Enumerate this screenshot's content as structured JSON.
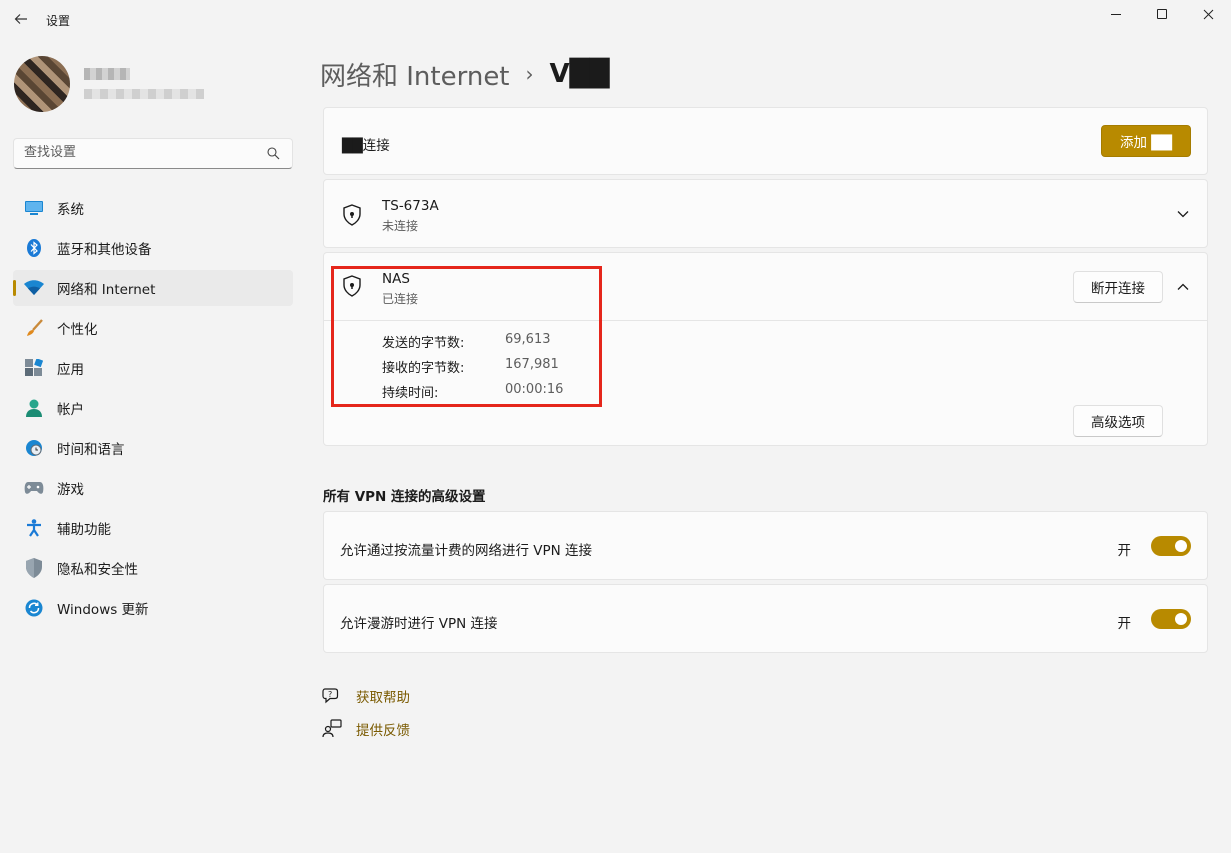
{
  "window": {
    "title": "设置"
  },
  "user": {
    "name": "",
    "email": ""
  },
  "search": {
    "placeholder": "查找设置"
  },
  "sidebar": {
    "items": [
      {
        "label": "系统",
        "icon": "system-icon"
      },
      {
        "label": "蓝牙和其他设备",
        "icon": "bluetooth-icon"
      },
      {
        "label": "网络和 Internet",
        "icon": "wifi-icon",
        "active": true
      },
      {
        "label": "个性化",
        "icon": "brush-icon"
      },
      {
        "label": "应用",
        "icon": "apps-icon"
      },
      {
        "label": "帐户",
        "icon": "account-icon"
      },
      {
        "label": "时间和语言",
        "icon": "globe-clock-icon"
      },
      {
        "label": "游戏",
        "icon": "gamepad-icon"
      },
      {
        "label": "辅助功能",
        "icon": "accessibility-icon"
      },
      {
        "label": "隐私和安全性",
        "icon": "shield-icon"
      },
      {
        "label": "Windows 更新",
        "icon": "update-icon"
      }
    ]
  },
  "breadcrumb": {
    "parent": "网络和 Internet",
    "separator": "›",
    "current": "V██"
  },
  "vpn_connections": {
    "label": "██连接",
    "add_button": "添加 ██"
  },
  "connections": [
    {
      "name": "TS-673A",
      "status": "未连接"
    },
    {
      "name": "NAS",
      "status": "已连接",
      "disconnect_button": "断开连接",
      "advanced_button": "高级选项",
      "stats": [
        {
          "label": "发送的字节数:",
          "value": "69,613"
        },
        {
          "label": "接收的字节数:",
          "value": "167,981"
        },
        {
          "label": "持续时间:",
          "value": "00:00:16"
        }
      ]
    }
  ],
  "advanced": {
    "title": "所有 VPN 连接的高级设置",
    "settings": [
      {
        "label": "允许通过按流量计费的网络进行 VPN 连接",
        "state": "开",
        "on": true
      },
      {
        "label": "允许漫游时进行 VPN 连接",
        "state": "开",
        "on": true
      }
    ]
  },
  "links": {
    "help": "获取帮助",
    "feedback": "提供反馈"
  },
  "colors": {
    "accent": "#b88a00",
    "highlight": "#e5261b"
  }
}
